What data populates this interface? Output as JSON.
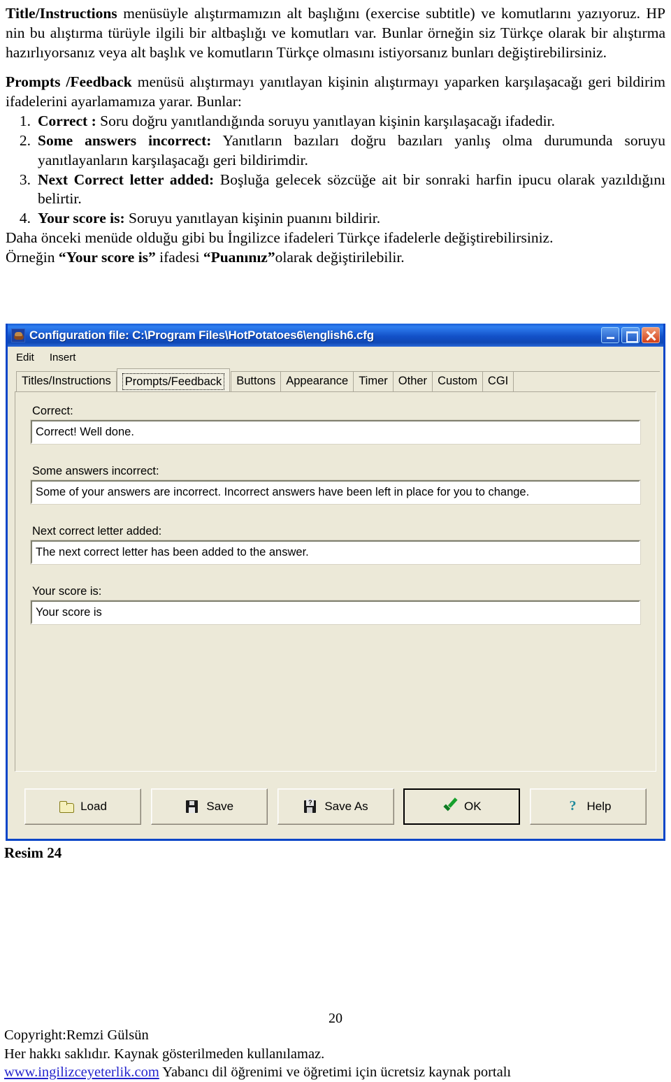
{
  "document": {
    "para1": {
      "lead": "Title/Instructions",
      "text": " menüsüyle alıştırmamızın alt başlığını (exercise subtitle) ve komutlarını yazıyoruz. HP nin bu alıştırma türüyle ilgili bir altbaşlığı ve komutları var. Bunlar örneğin siz Türkçe olarak bir alıştırma hazırlıyorsanız veya alt başlık ve komutların Türkçe olmasını istiyorsanız bunları değiştirebilirsiniz."
    },
    "para2": {
      "lead": "Prompts /Feedback",
      "text": " menüsü alıştırmayı yanıtlayan kişinin alıştırmayı yaparken karşılaşacağı geri bildirim ifadelerini ayarlamamıza yarar. Bunlar:"
    },
    "list": [
      {
        "num": "1.",
        "lead": "Correct :",
        "text": " Soru doğru yanıtlandığında soruyu yanıtlayan kişinin karşılaşacağı ifadedir."
      },
      {
        "num": "2.",
        "lead": "Some answers incorrect:",
        "text": " Yanıtların bazıları doğru bazıları yanlış olma durumunda soruyu yanıtlayanların karşılaşacağı geri bildirimdir."
      },
      {
        "num": "3.",
        "lead": "Next Correct letter added:",
        "text": " Boşluğa gelecek sözcüğe ait bir sonraki harfin ipucu olarak yazıldığını belirtir."
      },
      {
        "num": "4.",
        "lead": "Your score is:",
        "text": " Soruyu yanıtlayan kişinin puanını bildirir."
      }
    ],
    "para3": "Daha önceki menüde olduğu gibi bu İngilizce ifadeleri Türkçe ifadelerle değiştirebilirsiniz.",
    "para4": {
      "pre": "Örneğin ",
      "quote1": "“Your score is”",
      "mid": " ifadesi ",
      "quote2": "“Puanınız”",
      "post": "olarak değiştirilebilir."
    },
    "figure_caption": "Resim 24"
  },
  "window": {
    "title": "Configuration file: C:\\Program Files\\HotPotatoes6\\english6.cfg",
    "icon": "hot-potatoes-icon",
    "controls": {
      "minimize": "minimize-icon",
      "maximize": "maximize-icon",
      "close": "close-icon"
    },
    "menu": [
      "Edit",
      "Insert"
    ],
    "tabs": [
      {
        "label": "Titles/Instructions",
        "active": false
      },
      {
        "label": "Prompts/Feedback",
        "active": true
      },
      {
        "label": "Buttons",
        "active": false
      },
      {
        "label": "Appearance",
        "active": false
      },
      {
        "label": "Timer",
        "active": false
      },
      {
        "label": "Other",
        "active": false
      },
      {
        "label": "Custom",
        "active": false
      },
      {
        "label": "CGI",
        "active": false
      }
    ],
    "fields": [
      {
        "label": "Correct:",
        "value": "Correct! Well done."
      },
      {
        "label": "Some answers incorrect:",
        "value": "Some of your answers are incorrect. Incorrect answers have been left in place for you to change."
      },
      {
        "label": "Next correct letter added:",
        "value": "The next correct letter has been added to the answer."
      },
      {
        "label": "Your score is:",
        "value": "Your score is"
      }
    ],
    "buttons": [
      {
        "label": "Load",
        "icon": "folder-open-icon",
        "default": false
      },
      {
        "label": "Save",
        "icon": "floppy-disk-icon",
        "default": false
      },
      {
        "label": "Save As",
        "icon": "floppy-disk-question-icon",
        "default": false
      },
      {
        "label": "OK",
        "icon": "green-check-icon",
        "default": true
      },
      {
        "label": "Help",
        "icon": "question-mark-icon",
        "default": false
      }
    ],
    "colors": {
      "titlebar": "#1351c8",
      "face": "#ece9d8",
      "border": "#0a46c8"
    }
  },
  "footer": {
    "page_number": "20",
    "line1": "Copyright:Remzi Gülsün",
    "line2": "Her hakkı saklıdır. Kaynak gösterilmeden kullanılamaz.",
    "link": "www.ingilizceyeterlik.com",
    "line3": " Yabancı dil öğrenimi ve öğretimi için ücretsiz kaynak portalı"
  }
}
